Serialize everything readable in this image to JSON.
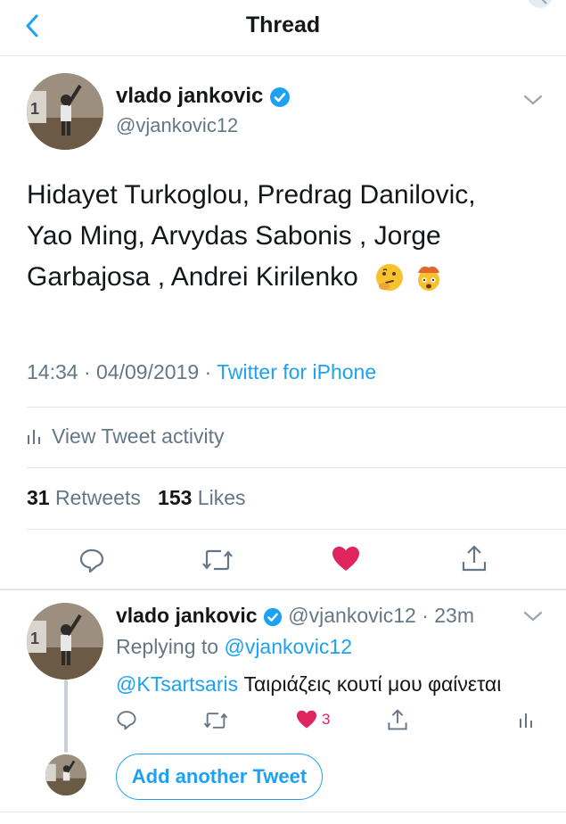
{
  "header": {
    "title": "Thread"
  },
  "tweet": {
    "display_name": "vlado jankovic",
    "handle": "@vjankovic12",
    "text_lines": [
      "Hidayet Turkoglou, Predrag Danilovic,",
      "Yao Ming, Arvydas Sabonis , Jorge",
      "Garbajosa , Andrei Kirilenko"
    ],
    "time_date": "14:34 · 04/09/2019 · ",
    "source": "Twitter for iPhone",
    "activity_label": "View Tweet activity",
    "retweets_count": "31",
    "retweets_label": "Retweets",
    "likes_count": "153",
    "likes_label": "Likes"
  },
  "reply": {
    "display_name": "vlado jankovic",
    "handle_time": "@vjankovic12 · 23m",
    "replying_prefix": "Replying to ",
    "replying_handle": "@vjankovic12",
    "mention": "@KTsartsaris",
    "text": " Ταιριάζεις κουτί μου φαίνεται",
    "like_count": "3"
  },
  "compose": {
    "add_button_label": "Add another Tweet"
  },
  "colors": {
    "accent": "#1da1f2",
    "like": "#e0245e",
    "muted": "#657786"
  },
  "icons": [
    "back-chevron-icon",
    "verified-badge-icon",
    "chevron-down-icon",
    "bar-chart-icon",
    "reply-icon",
    "retweet-icon",
    "heart-icon",
    "share-icon",
    "thinking-face-emoji",
    "exploding-head-emoji"
  ]
}
